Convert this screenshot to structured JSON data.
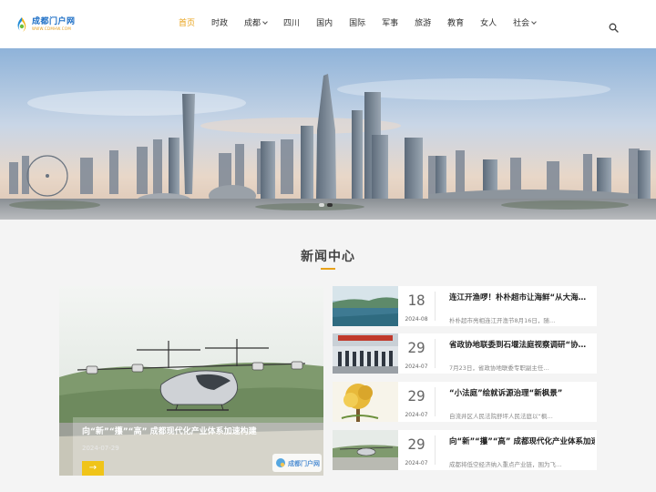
{
  "header": {
    "logo_name": "成都门户网",
    "logo_url": "WWW.CDMHW.COM",
    "nav": [
      {
        "label": "首页",
        "active": true,
        "dropdown": false
      },
      {
        "label": "时政",
        "active": false,
        "dropdown": false
      },
      {
        "label": "成都",
        "active": false,
        "dropdown": true
      },
      {
        "label": "四川",
        "active": false,
        "dropdown": false
      },
      {
        "label": "国内",
        "active": false,
        "dropdown": false
      },
      {
        "label": "国际",
        "active": false,
        "dropdown": false
      },
      {
        "label": "军事",
        "active": false,
        "dropdown": false
      },
      {
        "label": "旅游",
        "active": false,
        "dropdown": false
      },
      {
        "label": "教育",
        "active": false,
        "dropdown": false
      },
      {
        "label": "女人",
        "active": false,
        "dropdown": false
      },
      {
        "label": "社会",
        "active": false,
        "dropdown": true
      }
    ],
    "search_icon": "search-icon"
  },
  "banner": {
    "slides": 2,
    "active_slide": 1
  },
  "section": {
    "title": "新闻中心"
  },
  "featured": {
    "title": "向“新”“攥”“高” 成都现代化产业体系加速构建",
    "date": "2024-07-29",
    "arrow": "→",
    "watermark": "成都门户网"
  },
  "news": [
    {
      "day": "18",
      "ym": "2024-08",
      "title": "连江开渔啰！朴朴超市让海鲜“从大海…",
      "desc": "朴朴超市亮相连江开渔节8月16日，随…"
    },
    {
      "day": "29",
      "ym": "2024-07",
      "title": "省政协地联委到石堰法庭视察调研“协…",
      "desc": "7月23日，省政协地联委专职副主任…"
    },
    {
      "day": "29",
      "ym": "2024-07",
      "title": "“小法庭”绘就诉源治理“新枫景”",
      "desc": "自流井区人民法院舒坪人民法庭以“枫…"
    },
    {
      "day": "29",
      "ym": "2024-07",
      "title": "向“新”“攥”“高” 成都现代化产业体系加速",
      "desc": "成都将低空经济纳入重点产业链，围为飞…"
    }
  ],
  "colors": {
    "accent": "#e8a219",
    "logo_blue": "#1e6fc6",
    "arrow_btn": "#f0c419"
  }
}
